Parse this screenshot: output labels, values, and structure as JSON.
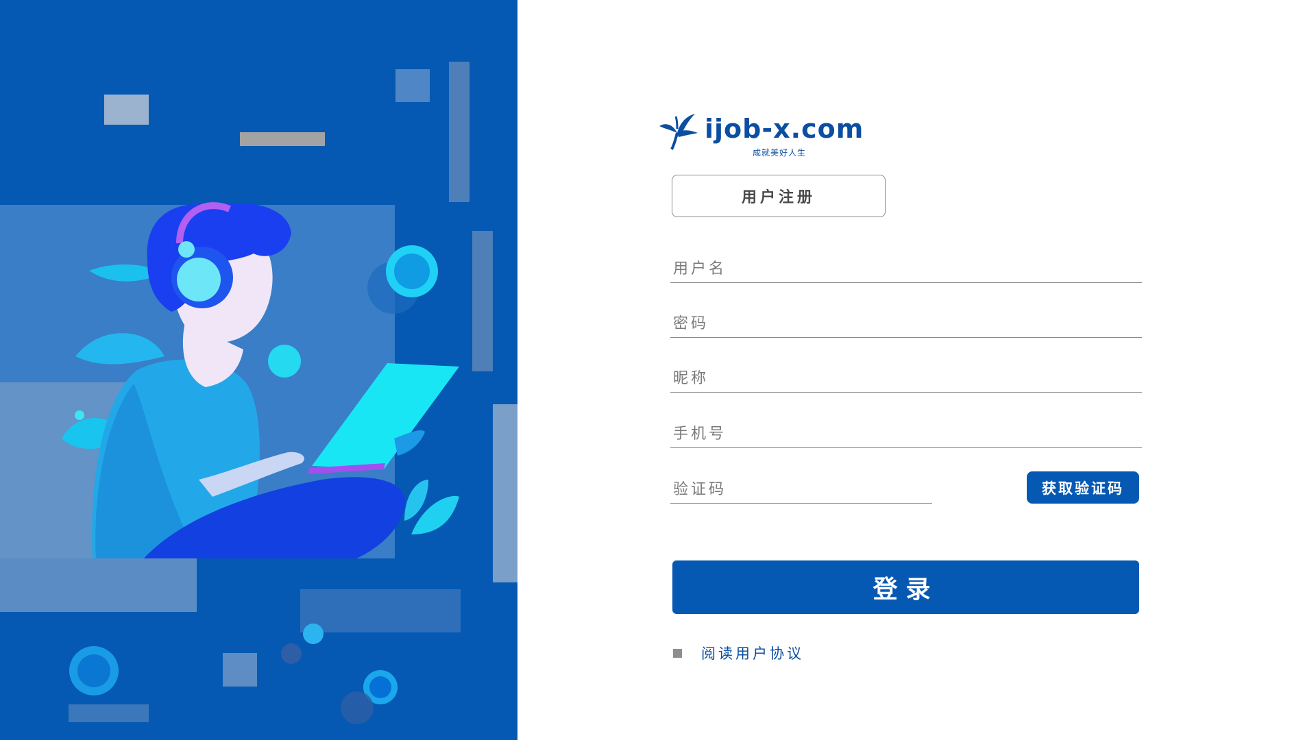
{
  "logo": {
    "text": "ijob-x.com",
    "slogan": "成就美好人生"
  },
  "register_tab": {
    "label": "用户注册"
  },
  "form": {
    "username_placeholder": "用户名",
    "password_placeholder": "密码",
    "nickname_placeholder": "昵称",
    "phone_placeholder": "手机号",
    "code_placeholder": "验证码",
    "get_code_label": "获取验证码",
    "login_label": "登录",
    "agreement_label": "阅读用户协议"
  },
  "colors": {
    "brand_blue": "#0559b3",
    "logo_blue": "#0b4ea2",
    "line_gray": "#8a8a8a"
  },
  "icons": {
    "logo_mark": "leaf-bird-icon",
    "checkbox": "checkbox-icon"
  }
}
